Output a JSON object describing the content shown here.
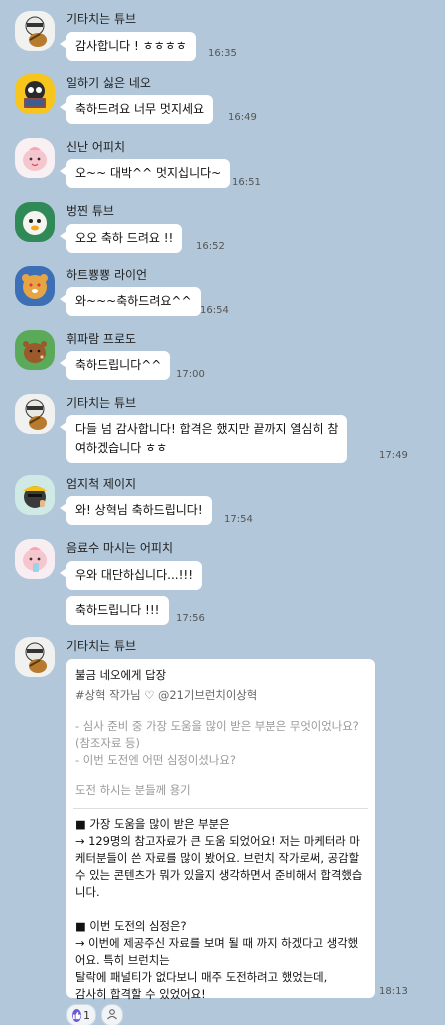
{
  "messages": [
    {
      "sender": "기타치는 튜브",
      "text": "감사합니다 ! ㅎㅎㅎㅎ",
      "time": "16:35",
      "avatar": "tube-guitar"
    },
    {
      "sender": "일하기 싫은 네오",
      "text": "축하드려요 너무 멋지세요",
      "time": "16:49",
      "avatar": "neo-laptop"
    },
    {
      "sender": "신난 어피치",
      "text": "오~~ 대박^^ 멋지십니다~",
      "time": "16:51",
      "avatar": "apeach"
    },
    {
      "sender": "벙찐 튜브",
      "text": "오오 축하 드려요 !!",
      "time": "16:52",
      "avatar": "tube-dumbfounded"
    },
    {
      "sender": "하트뿅뿅 라이언",
      "text": "와~~~축하드려요^^",
      "time": "16:54",
      "avatar": "ryan-heart"
    },
    {
      "sender": "휘파람 프로도",
      "text": "축하드립니다^^",
      "time": "17:00",
      "avatar": "frodo-whistle"
    },
    {
      "sender": "기타치는 튜브",
      "text_line1": "다들 넘 감사합니다! 합격은 했지만 끝까지 열심히 참",
      "text_line2": "여하겠습니다 ㅎㅎ",
      "time": "17:49",
      "avatar": "tube-guitar"
    },
    {
      "sender": "엄지척 제이지",
      "text": "와! 상혁님 축하드립니다!",
      "time": "17:54",
      "avatar": "jayg-thumbs"
    },
    {
      "sender": "음료수 마시는 어피치",
      "text1": "우와 대단하십니다...!!!",
      "text2": "축하드립니다 !!!",
      "time": "17:56",
      "avatar": "apeach-drink"
    },
    {
      "sender": "기타치는 튜브",
      "time": "18:13",
      "avatar": "tube-guitar"
    }
  ],
  "reply_card": {
    "title": "불금 네오에게 답장",
    "meta": "#상혁 작가님  ♡ @21기브런치이상혁",
    "quoted": [
      "- 심사 준비 중 가장 도움을 많이 받은 부분은 무엇이었나요? (참조자료 등)",
      "- 이번 도전엔 어떤 심정이셨나요?",
      "도전 하시는 분들께 용기"
    ],
    "section1": [
      "■ 가장 도움을 많이 받은 부분은",
      "→ 129명의 참고자료가 큰 도움 되었어요! 저는 마케터라 마케터분들이 쓴 자료를 많이 봤어요. 브런치 작가로써, 공감할 수 있는 콘텐츠가 뭐가 있을지 생각하면서 준비해서 합격했습니다."
    ],
    "section2": [
      "■ 이번 도전의 심정은?",
      "→ 이번에 제공주신 자료를 보며 될 때 까지 하겠다고 생각했어요. 특히 브런치는",
      "탈락에 패널티가 없다보니 매주 도전하려고 했었는데,",
      "감사히 합격할 수 있었어요!"
    ]
  },
  "reactions": {
    "like_count": "1",
    "like_icon": "thumbs-up-icon",
    "person_icon": "person-icon"
  },
  "colors": {
    "background": "#b2c7d9",
    "bubble": "#ffffff",
    "like_accent": "#6b5cd6"
  }
}
